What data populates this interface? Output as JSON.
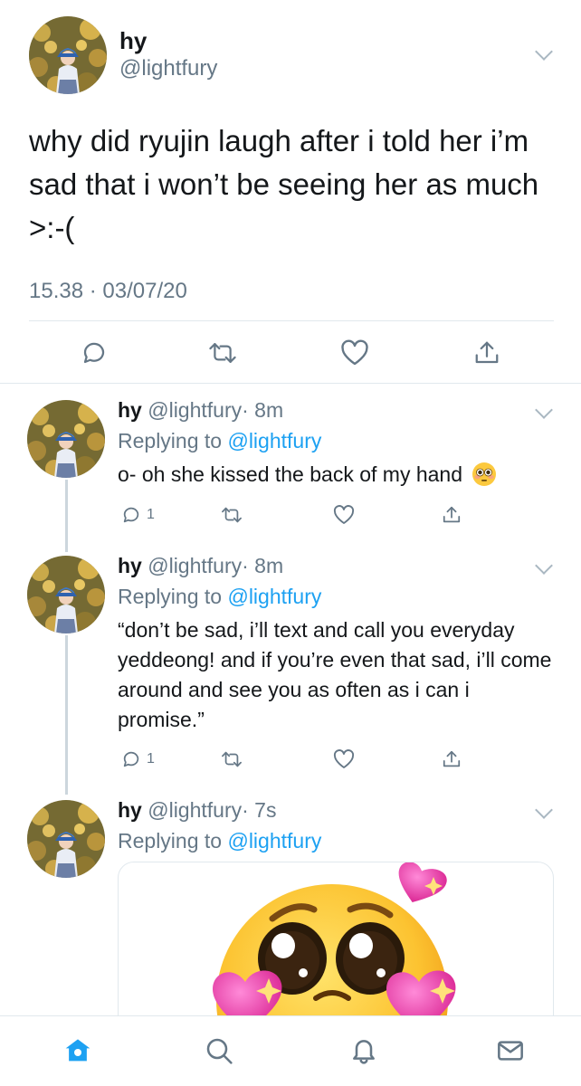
{
  "main_tweet": {
    "name": "hy",
    "handle": "@lightfury",
    "text": "why did ryujin laugh after i told her i’m sad that i won’t be seeing her as much >:-(",
    "timestamp": "15.38 · 03/07/20",
    "actions": [
      "reply-icon",
      "retweet-icon",
      "like-icon",
      "share-icon"
    ]
  },
  "replies": [
    {
      "name": "hy",
      "handle": "@lightfury",
      "age": "· 8m",
      "replying_label": "Replying to",
      "replying_to": "@lightfury",
      "text": "o- oh she kissed the back of my hand",
      "emoji": "flushed-face-emoji",
      "reply_count": "1"
    },
    {
      "name": "hy",
      "handle": "@lightfury",
      "age": "· 8m",
      "replying_label": "Replying to",
      "replying_to": "@lightfury",
      "text": "“don’t be sad, i’ll text and call you everyday yeddeong! and if you’re even that sad, i’ll come around and see you as often as i can i promise.”",
      "reply_count": "1"
    },
    {
      "name": "hy",
      "handle": "@lightfury",
      "age": "· 7s",
      "replying_label": "Replying to",
      "replying_to": "@lightfury",
      "media": "pleading-face-emoji-with-hearts"
    }
  ],
  "tabbar": {
    "tabs": [
      "home-tab",
      "search-tab",
      "notifications-tab",
      "messages-tab"
    ],
    "active": "home-tab"
  },
  "colors": {
    "accent": "#1da1f2",
    "secondary_text": "#657786",
    "icon": "#657786",
    "divider": "#e1e8ed",
    "thread_line": "#ccd6dd"
  }
}
